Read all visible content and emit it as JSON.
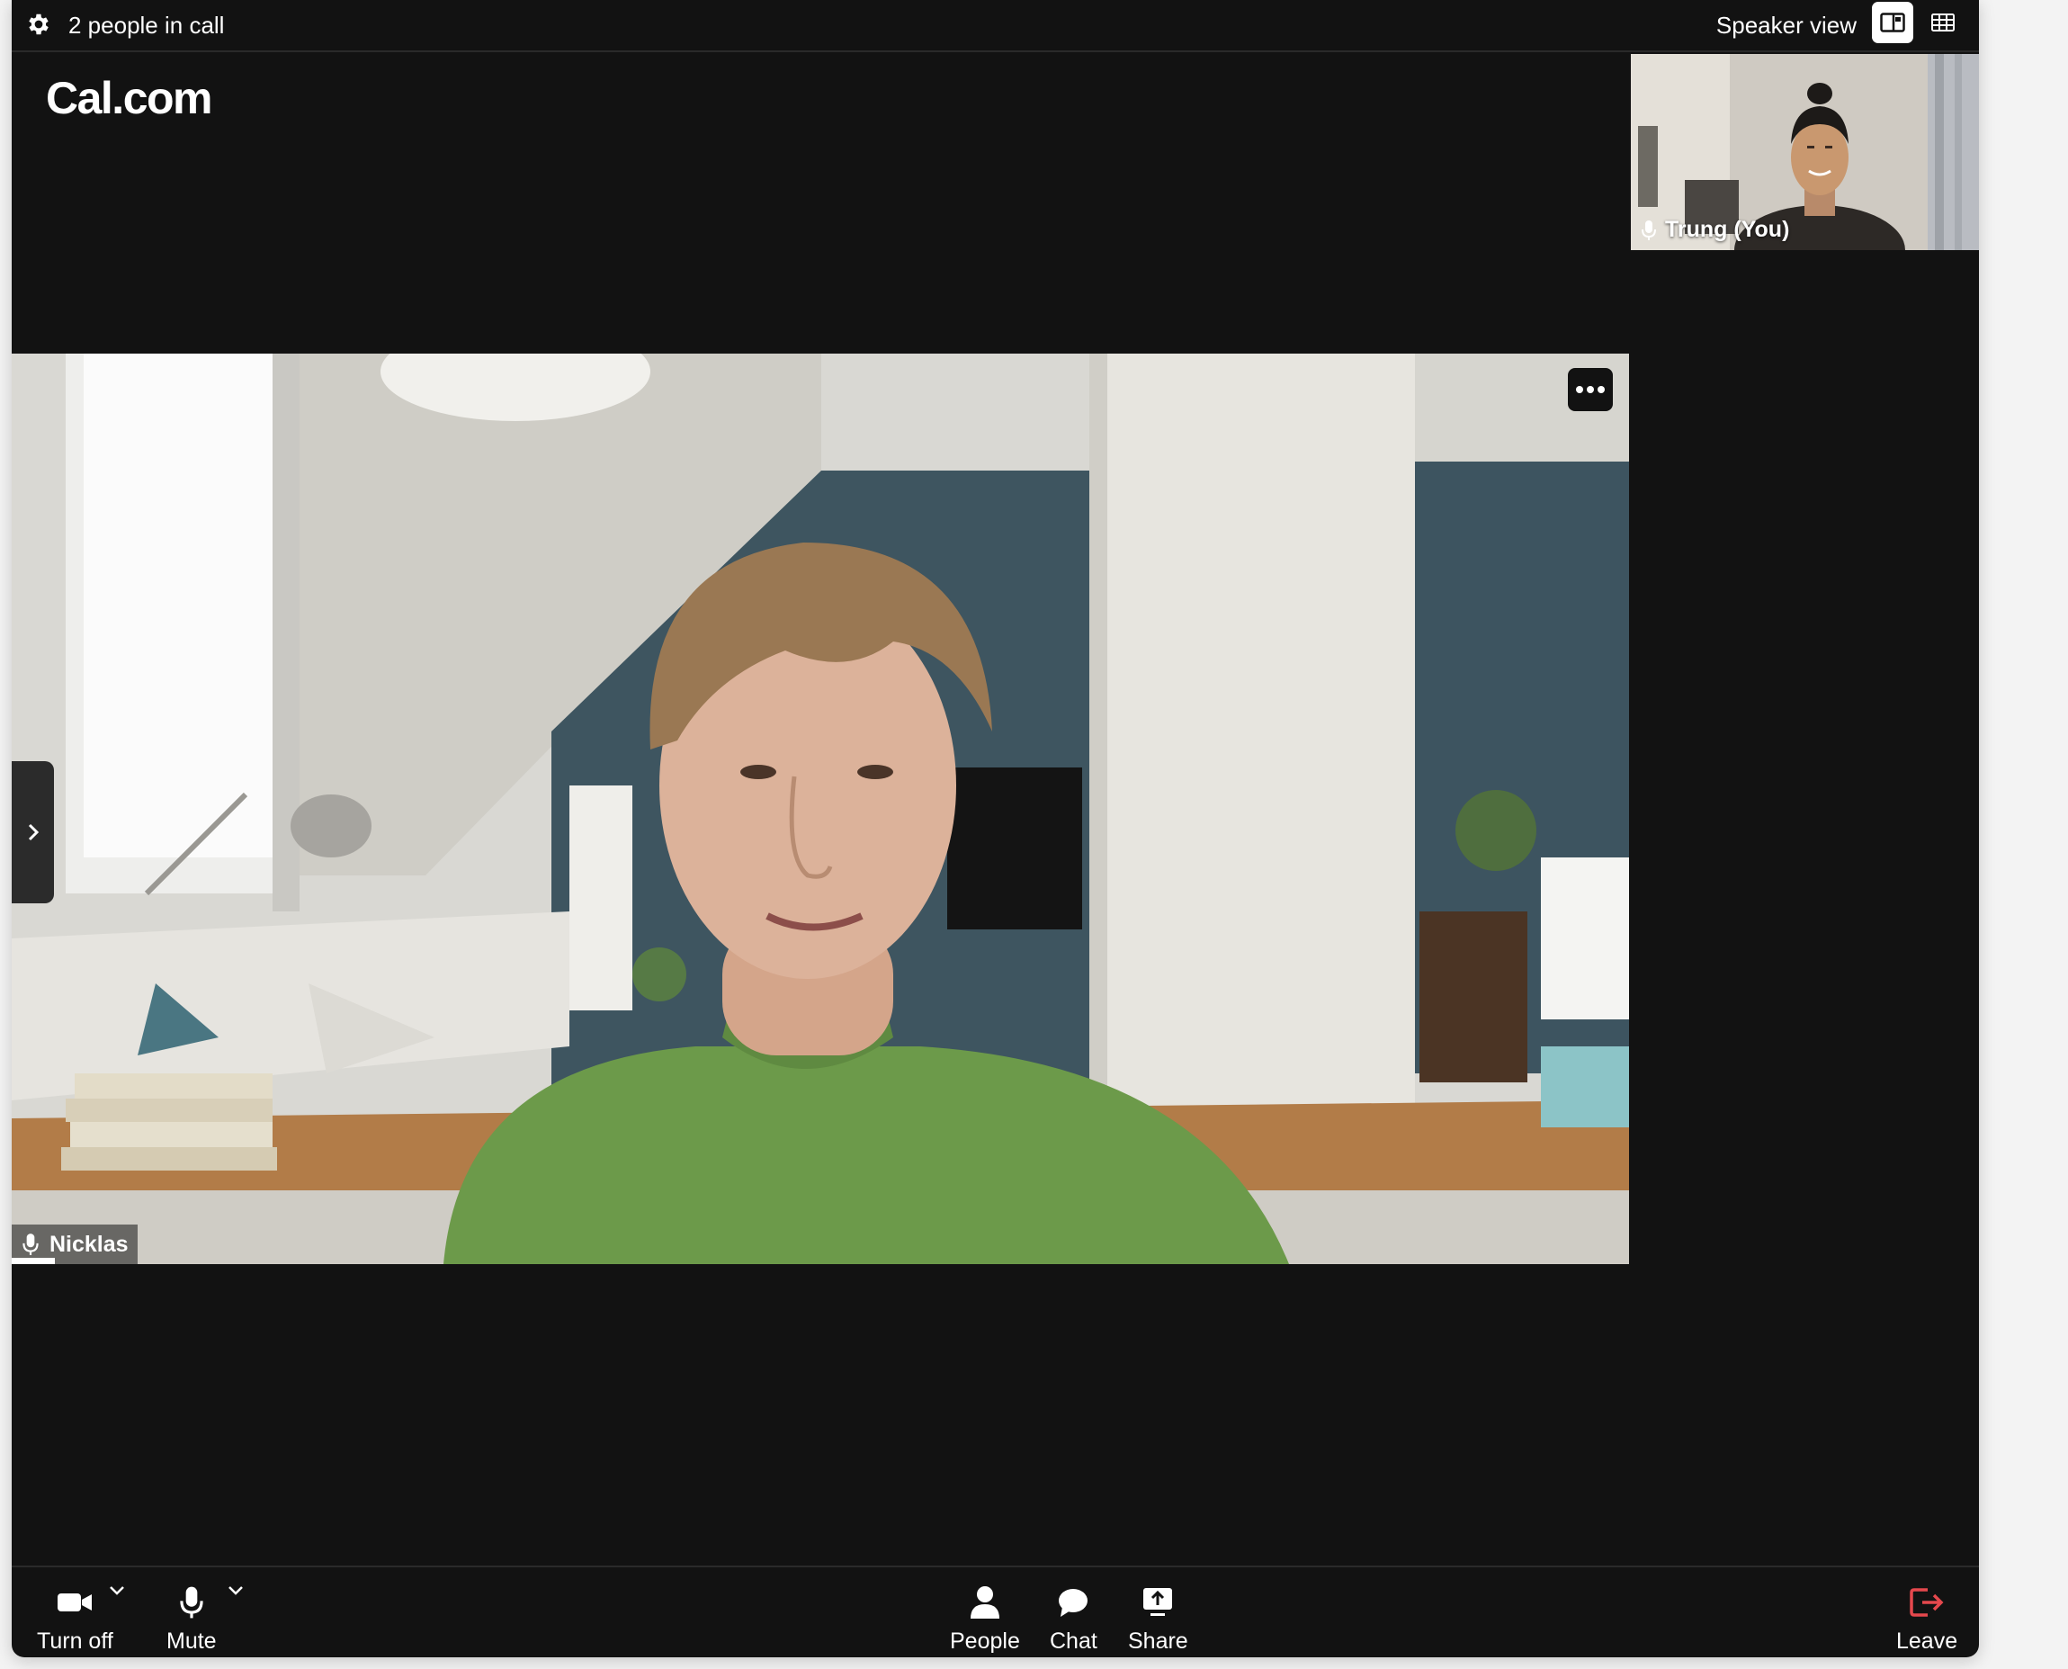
{
  "topbar": {
    "people_count": "2 people in call",
    "view_mode": "Speaker view",
    "icons": [
      "gear-icon",
      "speaker-view-icon",
      "grid-view-icon"
    ]
  },
  "logo": "Cal.com",
  "self_view": {
    "name": "Trung (You)"
  },
  "speaker": {
    "name": "Nicklas"
  },
  "controls": {
    "camera": "Turn off",
    "mic": "Mute",
    "people": "People",
    "chat": "Chat",
    "share": "Share",
    "leave": "Leave"
  },
  "colors": {
    "background": "#121212",
    "leave_icon": "#e5484d",
    "text": "#ffffff"
  }
}
